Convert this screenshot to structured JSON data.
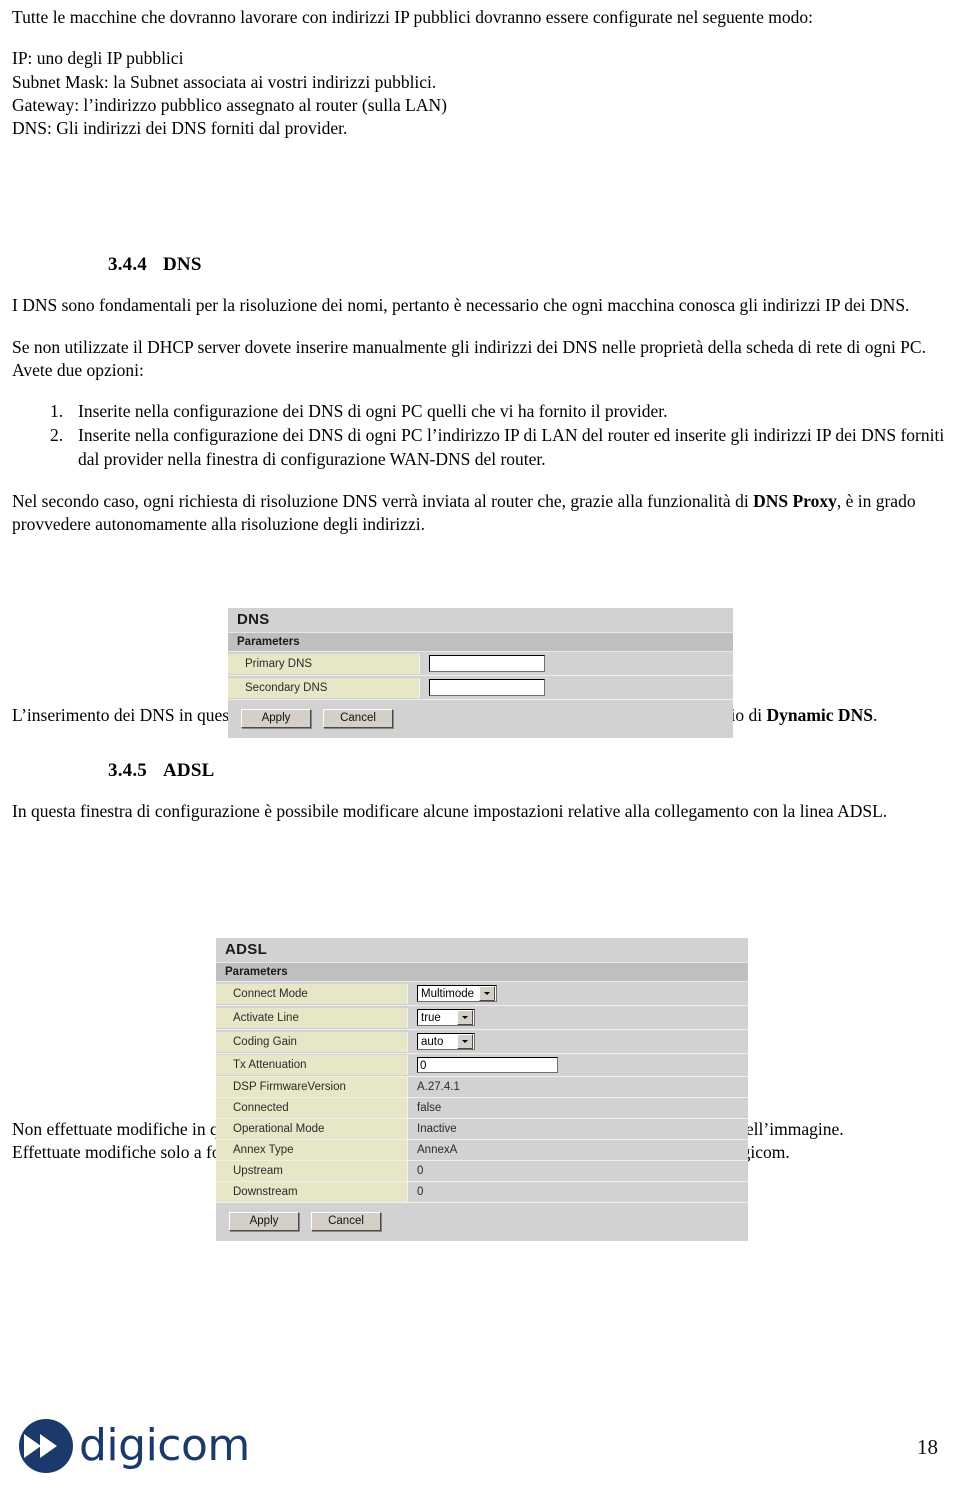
{
  "document": {
    "page_number": "18",
    "brand": "digicom"
  },
  "intro": {
    "lead": "Tutte le macchine che dovranno lavorare con indirizzi IP pubblici dovranno essere configurate nel seguente modo:",
    "lines": [
      "IP: uno degli IP pubblici",
      "Subnet Mask: la Subnet associata ai vostri indirizzi pubblici.",
      "Gateway: l’indirizzo pubblico assegnato al router (sulla LAN)",
      "DNS: Gli indirizzi dei DNS forniti dal provider."
    ]
  },
  "section_dns": {
    "number": "3.4.4",
    "title": "DNS",
    "p1": "I DNS sono fondamentali per la risoluzione dei nomi, pertanto è necessario che ogni macchina conosca gli indirizzi IP dei DNS.",
    "p2": "Se non utilizzate il DHCP server dovete inserire manualmente gli indirizzi dei DNS nelle proprietà della scheda di rete di ogni PC. Avete due opzioni:",
    "list": [
      {
        "marker": "1.",
        "text": "Inserite nella configurazione dei DNS di ogni PC quelli che vi ha fornito il provider."
      },
      {
        "marker": "2.",
        "text": "Inserite nella configurazione dei DNS di ogni PC l’indirizzo IP di LAN del router ed inserite gli indirizzi IP dei DNS forniti dal provider nella finestra di configurazione WAN-DNS del router."
      }
    ],
    "p3_before": "Nel secondo caso, ogni richiesta di risoluzione DNS verrà inviata al router che, grazie alla funzionalità di ",
    "p3_bold": "DNS Proxy",
    "p3_after": ", è in grado provvedere autonomamente alla risoluzione degli indirizzi.",
    "p4_before": "L’inserimento dei DNS in questa finestra è necessario anche per poter utilizzare correttamente il servizio di ",
    "p4_bold": "Dynamic DNS",
    "p4_after": "."
  },
  "dns_panel": {
    "title": "DNS",
    "subhead": "Parameters",
    "rows": [
      {
        "label": "Primary DNS",
        "value": "",
        "control": "textbox"
      },
      {
        "label": "Secondary DNS",
        "value": "",
        "control": "textbox"
      }
    ],
    "apply_label": "Apply",
    "cancel_label": "Cancel"
  },
  "section_adsl": {
    "number": "3.4.5",
    "title": "ADSL",
    "p1": "In questa finestra di configurazione è possibile modificare alcune impostazioni relative alla collegamento con la linea ADSL.",
    "p2_line1": "Non effettuate modifiche in questa pagina di configurazione, lasciate ivariati i parametri come mostrati nell’immagine.",
    "p2_line2": "Effettuate modifiche solo a foronte di un esplicita richiesta del vostro provider o del supporto tecnico Digicom."
  },
  "adsl_panel": {
    "title": "ADSL",
    "subhead": "Parameters",
    "rows": [
      {
        "label": "Connect Mode",
        "value": "Multimode",
        "control": "select"
      },
      {
        "label": "Activate Line",
        "value": "true",
        "control": "select"
      },
      {
        "label": "Coding Gain",
        "value": "auto",
        "control": "select"
      },
      {
        "label": "Tx Attenuation",
        "value": "0",
        "control": "textbox"
      },
      {
        "label": "DSP FirmwareVersion",
        "value": "A.27.4.1",
        "control": "text"
      },
      {
        "label": "Connected",
        "value": "false",
        "control": "text"
      },
      {
        "label": "Operational Mode",
        "value": "Inactive",
        "control": "text"
      },
      {
        "label": "Annex Type",
        "value": "AnnexA",
        "control": "text"
      },
      {
        "label": "Upstream",
        "value": "0",
        "control": "text"
      },
      {
        "label": "Downstream",
        "value": "0",
        "control": "text"
      }
    ],
    "apply_label": "Apply",
    "cancel_label": "Cancel"
  },
  "colors": {
    "panel_bg": "#d2d2d2",
    "label_bg": "#e7e7c8",
    "subhead_bg": "#bfbfbf",
    "brand_blue": "#1b3a6b"
  }
}
